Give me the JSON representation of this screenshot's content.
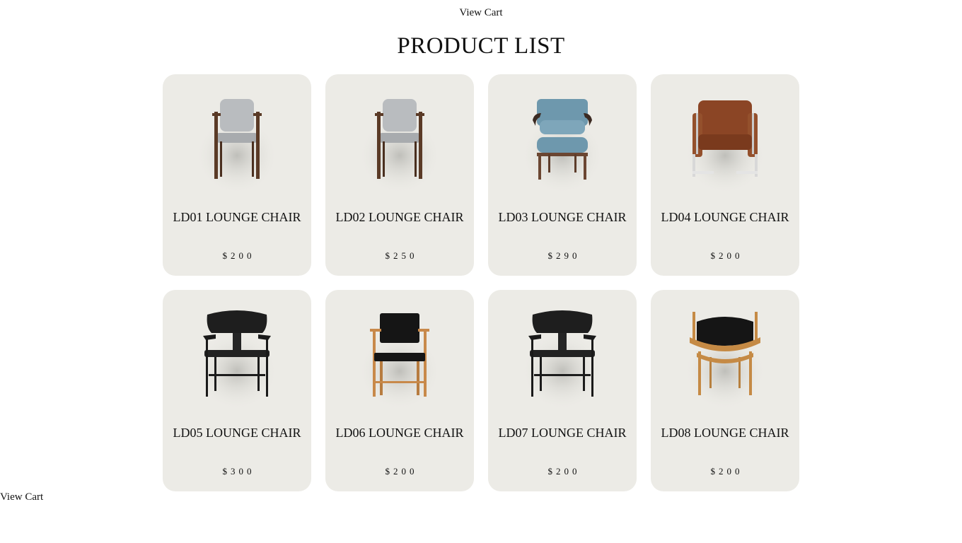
{
  "header": {
    "view_cart_label": "View Cart",
    "title": "PRODUCT LIST"
  },
  "products": [
    {
      "name": "LD01 LOUNGE CHAIR",
      "price": "$200",
      "icon": "upholstered-gray-chair-icon",
      "style": "gray"
    },
    {
      "name": "LD02 LOUNGE CHAIR",
      "price": "$250",
      "icon": "upholstered-gray-chair-icon",
      "style": "gray"
    },
    {
      "name": "LD03 LOUNGE CHAIR",
      "price": "$290",
      "icon": "blue-lounge-chair-icon",
      "style": "blue"
    },
    {
      "name": "LD04 LOUNGE CHAIR",
      "price": "$200",
      "icon": "brown-leather-chair-icon",
      "style": "leather"
    },
    {
      "name": "LD05 LOUNGE CHAIR",
      "price": "$300",
      "icon": "black-wood-chair-icon",
      "style": "black"
    },
    {
      "name": "LD06 LOUNGE CHAIR",
      "price": "$200",
      "icon": "black-oak-chair-icon",
      "style": "oakblack"
    },
    {
      "name": "LD07 LOUNGE CHAIR",
      "price": "$200",
      "icon": "black-wood-chair-icon",
      "style": "black"
    },
    {
      "name": "LD08 LOUNGE CHAIR",
      "price": "$200",
      "icon": "oak-shell-chair-icon",
      "style": "oakshell"
    }
  ],
  "footer": {
    "view_cart_label": "View Cart"
  },
  "colors": {
    "card_bg": "#ecebe6",
    "page_bg": "#ffffff",
    "text": "#111111"
  }
}
